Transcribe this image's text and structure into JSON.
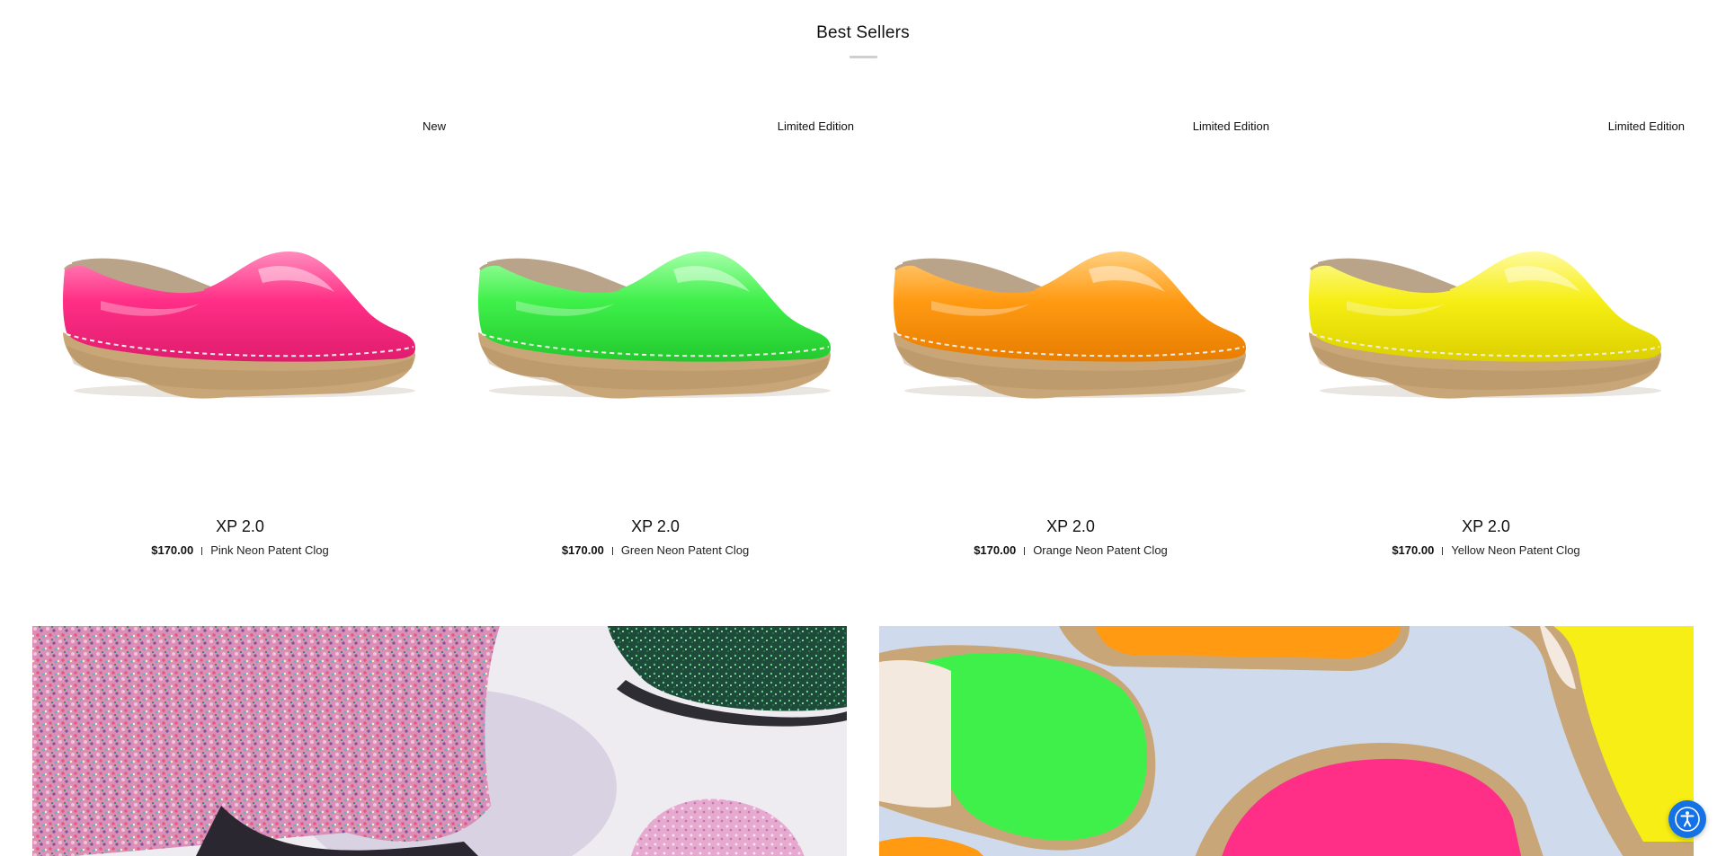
{
  "section": {
    "title": "Best Sellers"
  },
  "products": [
    {
      "badge": "New",
      "name": "XP 2.0",
      "price": "$170.00",
      "desc": "Pink Neon Patent Clog",
      "color": "#ff2e86",
      "color_dark": "#e01c6e",
      "color_light": "#ff8cbd"
    },
    {
      "badge": "Limited Edition",
      "name": "XP 2.0",
      "price": "$170.00",
      "desc": "Green Neon Patent Clog",
      "color": "#3ff04a",
      "color_dark": "#22c92e",
      "color_light": "#a4ffa8"
    },
    {
      "badge": "Limited Edition",
      "name": "XP 2.0",
      "price": "$170.00",
      "desc": "Orange Neon Patent Clog",
      "color": "#ff9a12",
      "color_dark": "#e87d00",
      "color_light": "#ffcf7f"
    },
    {
      "badge": "Limited Edition",
      "name": "XP 2.0",
      "price": "$170.00",
      "desc": "Yellow Neon Patent Clog",
      "color": "#f6ee14",
      "color_dark": "#dcd000",
      "color_light": "#fffa9c"
    }
  ],
  "icons": {
    "accessibility": "accessibility-icon"
  },
  "colors": {
    "sole": "#c9a677",
    "sole_dark": "#a98858",
    "collar": "#b9a48a",
    "a11y_bg": "#1472e6"
  }
}
